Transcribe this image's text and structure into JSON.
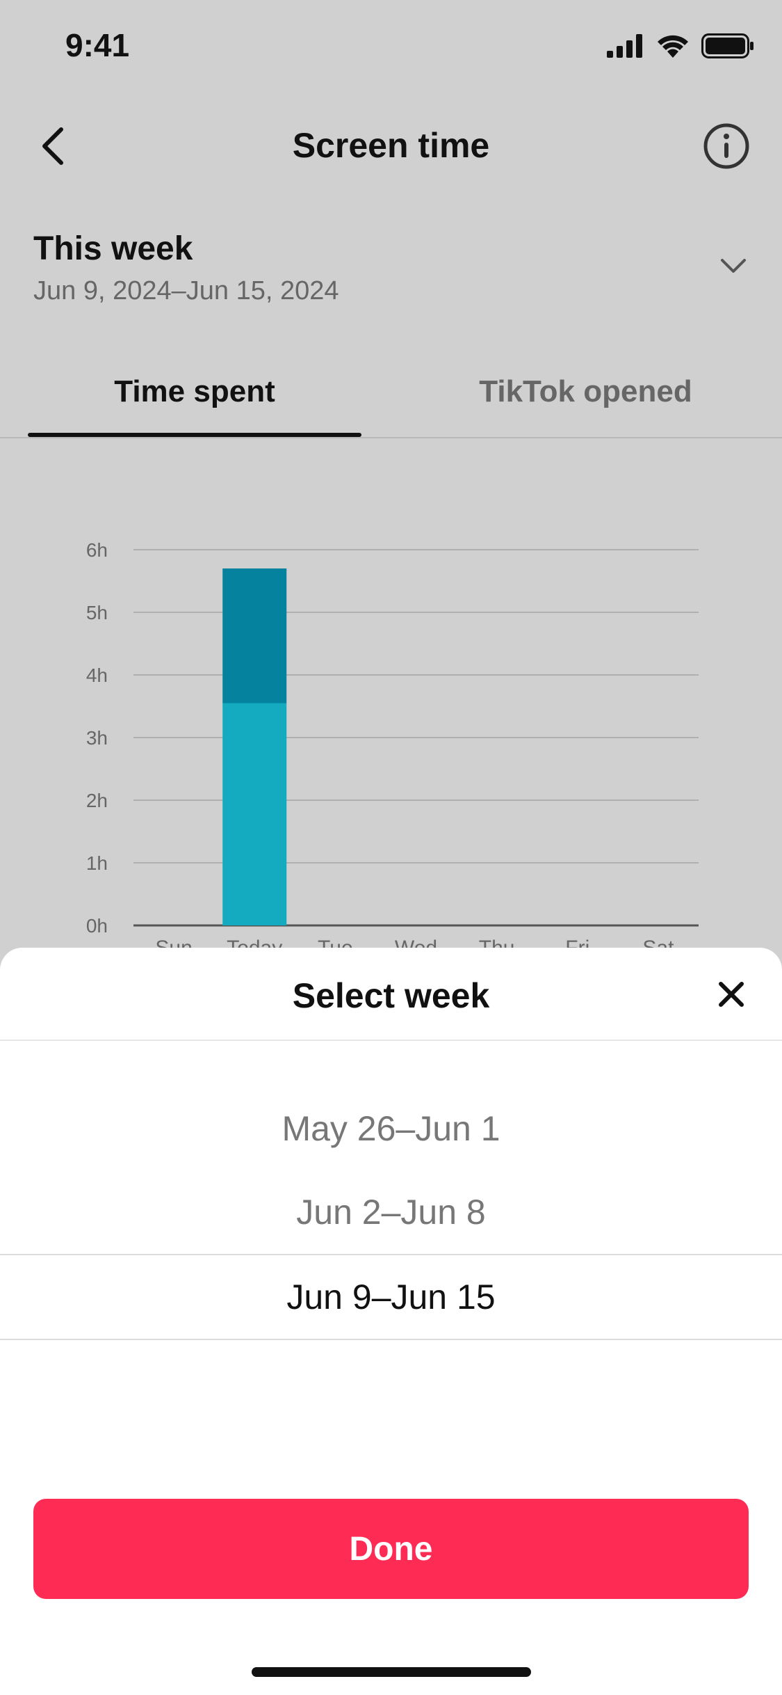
{
  "status_bar": {
    "time": "9:41"
  },
  "nav": {
    "title": "Screen time",
    "back_icon": "chevron-left-icon",
    "info_icon": "info-icon"
  },
  "week_selector": {
    "label": "This week",
    "range": "Jun 9, 2024–Jun 15, 2024",
    "chevron_icon": "chevron-down-icon"
  },
  "tabs": [
    {
      "label": "Time spent",
      "active": true
    },
    {
      "label": "TikTok opened",
      "active": false
    }
  ],
  "chart_data": {
    "type": "bar",
    "categories": [
      "Sun",
      "Today",
      "Tue",
      "Wed",
      "Thu",
      "Fri",
      "Sat"
    ],
    "series": [
      {
        "values": [
          0,
          3.55,
          0,
          0,
          0,
          0,
          0
        ],
        "color": "#14aabf"
      },
      {
        "values": [
          0,
          2.15,
          0,
          0,
          0,
          0,
          0
        ],
        "color": "#05829e"
      }
    ],
    "yticks": [
      "0h",
      "1h",
      "2h",
      "3h",
      "4h",
      "5h",
      "6h"
    ],
    "ylim": [
      0,
      6
    ],
    "grid": true,
    "stacked": true
  },
  "sheet": {
    "title": "Select week",
    "close_icon": "close-icon",
    "options": [
      {
        "label": "May 26–Jun 1",
        "selected": false
      },
      {
        "label": "Jun 2–Jun 8",
        "selected": false
      },
      {
        "label": "Jun 9–Jun 15",
        "selected": true
      }
    ],
    "done_label": "Done",
    "done_color": "#fe2c55"
  }
}
